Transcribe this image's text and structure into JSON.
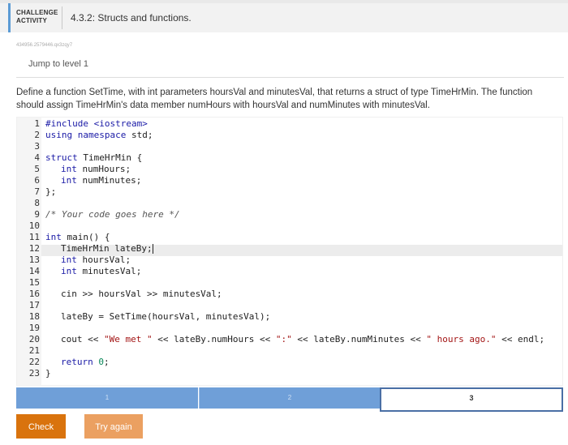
{
  "header": {
    "activity_label_line1": "CHALLENGE",
    "activity_label_line2": "ACTIVITY",
    "title": "4.3.2: Structs and functions."
  },
  "hash": "434956.2579446.qx3zqy7",
  "jump_link": "Jump to level 1",
  "description": "Define a function SetTime, with int parameters hoursVal and minutesVal, that returns a struct of type TimeHrMin. The function should assign TimeHrMin's data member numHours with hoursVal and numMinutes with minutesVal.",
  "code": {
    "line_numbers": [
      "1",
      "2",
      "3",
      "4",
      "5",
      "6",
      "7",
      "8",
      "9",
      "10",
      "11",
      "12",
      "13",
      "14",
      "15",
      "16",
      "17",
      "18",
      "19",
      "20",
      "21",
      "22",
      "23"
    ],
    "l1": "#include <iostream>",
    "l2_kw": "using",
    "l2_ns": "namespace",
    "l2_rest": " std;",
    "l4_kw": "struct",
    "l4_rest": " TimeHrMin {",
    "l5_kw": "int",
    "l5_rest": " numHours;",
    "l6_kw": "int",
    "l6_rest": " numMinutes;",
    "l7": "};",
    "l9": "/* Your code goes here */",
    "l11_kw": "int",
    "l11_rest": " main() {",
    "l12": "TimeHrMin lateBy;",
    "l13_kw": "int",
    "l13_rest": " hoursVal;",
    "l14_kw": "int",
    "l14_rest": " minutesVal;",
    "l16": "cin >> hoursVal >> minutesVal;",
    "l18": "lateBy = SetTime(hoursVal, minutesVal);",
    "l20_a": "cout << ",
    "l20_s1": "\"We met \"",
    "l20_b": " << lateBy.numHours << ",
    "l20_s2": "\":\"",
    "l20_c": " << lateBy.numMinutes << ",
    "l20_s3": "\" hours ago.\"",
    "l20_d": " << endl;",
    "l22_kw": "return",
    "l22_num": "0",
    "l22_end": ";",
    "l23": "}"
  },
  "levels": [
    "1",
    "2",
    "3"
  ],
  "buttons": {
    "check": "Check",
    "try_again": "Try again"
  },
  "colors": {
    "accent": "#5b9bd5",
    "level_fill": "#6f9fd8",
    "check_button": "#d9730d",
    "try_again_button": "#eba061"
  }
}
